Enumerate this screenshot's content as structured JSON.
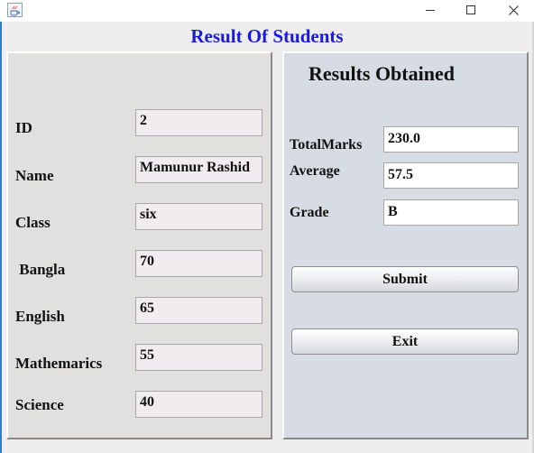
{
  "window": {
    "title": "",
    "controls": {
      "minimize": "—",
      "maximize": "☐",
      "close": "✕"
    },
    "icon": "java-cup-icon"
  },
  "heading": "Result Of Students",
  "colors": {
    "heading": "#1a1ae0",
    "left_panel": "#e2dfdf",
    "right_panel": "#d7dbe3",
    "window_edge": "#2e7bd1"
  },
  "student": {
    "fields": [
      {
        "label": "ID",
        "value": "2"
      },
      {
        "label": "Name",
        "value": "Mamunur Rashid"
      },
      {
        "label": "Class",
        "value": "six"
      },
      {
        "label": " Bangla",
        "value": "70"
      },
      {
        "label": "English",
        "value": "65"
      },
      {
        "label": "Mathemarics",
        "value": "55"
      },
      {
        "label": "Science",
        "value": "40"
      }
    ]
  },
  "results": {
    "title": "Results Obtained",
    "total_label": "TotalMarks",
    "total_value": "230.0",
    "average_label": "Average",
    "average_value": "57.5",
    "grade_label": "Grade",
    "grade_value": "B",
    "submit_label": "Submit",
    "exit_label": "Exit"
  }
}
